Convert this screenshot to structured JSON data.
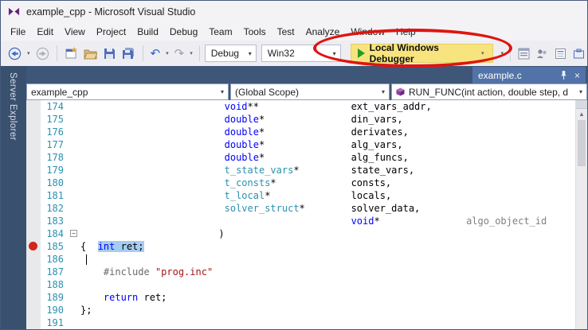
{
  "window": {
    "title": "example_cpp - Microsoft Visual Studio"
  },
  "menu": [
    "File",
    "Edit",
    "View",
    "Project",
    "Build",
    "Debug",
    "Team",
    "Tools",
    "Test",
    "Analyze",
    "Window",
    "Help"
  ],
  "toolbar": {
    "config": "Debug",
    "platform": "Win32",
    "debugger_button": "Local Windows Debugger"
  },
  "side_tab": "Server Explorer",
  "doc_tab": "example.c",
  "navbar": {
    "project": "example_cpp",
    "scope": "(Global Scope)",
    "member": "RUN_FUNC(int action, double step, d"
  },
  "colors": {
    "keyword": "#0000ff",
    "user_type": "#2b91af",
    "string": "#a31515",
    "line_number": "#2b91af",
    "breakpoint": "#d1261a",
    "selection": "#a6cdf0",
    "annotation_ellipse": "#de1510",
    "annotation_highlight": "#f8e47e",
    "tab_active": "#5273a7",
    "chrome": "#3e5678"
  },
  "editor": {
    "lines": [
      {
        "num": 174,
        "segments": [
          {
            "t": "                         ",
            "c": "pl"
          },
          {
            "t": "void",
            "c": "kw"
          },
          {
            "t": "**",
            "c": "pl"
          },
          {
            "t": "                ",
            "c": "pl"
          },
          {
            "t": "ext_vars_addr,",
            "c": "pl"
          }
        ]
      },
      {
        "num": 175,
        "segments": [
          {
            "t": "                         ",
            "c": "pl"
          },
          {
            "t": "double",
            "c": "kw"
          },
          {
            "t": "*",
            "c": "pl"
          },
          {
            "t": "               ",
            "c": "pl"
          },
          {
            "t": "din_vars,",
            "c": "pl"
          }
        ]
      },
      {
        "num": 176,
        "segments": [
          {
            "t": "                         ",
            "c": "pl"
          },
          {
            "t": "double",
            "c": "kw"
          },
          {
            "t": "*",
            "c": "pl"
          },
          {
            "t": "               ",
            "c": "pl"
          },
          {
            "t": "derivates,",
            "c": "pl"
          }
        ]
      },
      {
        "num": 177,
        "segments": [
          {
            "t": "                         ",
            "c": "pl"
          },
          {
            "t": "double",
            "c": "kw"
          },
          {
            "t": "*",
            "c": "pl"
          },
          {
            "t": "               ",
            "c": "pl"
          },
          {
            "t": "alg_vars,",
            "c": "pl"
          }
        ]
      },
      {
        "num": 178,
        "segments": [
          {
            "t": "                         ",
            "c": "pl"
          },
          {
            "t": "double",
            "c": "kw"
          },
          {
            "t": "*",
            "c": "pl"
          },
          {
            "t": "               ",
            "c": "pl"
          },
          {
            "t": "alg_funcs,",
            "c": "pl"
          }
        ]
      },
      {
        "num": 179,
        "segments": [
          {
            "t": "                         ",
            "c": "pl"
          },
          {
            "t": "t_state_vars",
            "c": "ty"
          },
          {
            "t": "*",
            "c": "pl"
          },
          {
            "t": "         ",
            "c": "pl"
          },
          {
            "t": "state_vars,",
            "c": "pl"
          }
        ]
      },
      {
        "num": 180,
        "segments": [
          {
            "t": "                         ",
            "c": "pl"
          },
          {
            "t": "t_consts",
            "c": "ty"
          },
          {
            "t": "*",
            "c": "pl"
          },
          {
            "t": "             ",
            "c": "pl"
          },
          {
            "t": "consts,",
            "c": "pl"
          }
        ]
      },
      {
        "num": 181,
        "segments": [
          {
            "t": "                         ",
            "c": "pl"
          },
          {
            "t": "t_local",
            "c": "ty"
          },
          {
            "t": "*",
            "c": "pl"
          },
          {
            "t": "              ",
            "c": "pl"
          },
          {
            "t": "locals,",
            "c": "pl"
          }
        ]
      },
      {
        "num": 182,
        "segments": [
          {
            "t": "                         ",
            "c": "pl"
          },
          {
            "t": "solver_struct",
            "c": "ty"
          },
          {
            "t": "*",
            "c": "pl"
          },
          {
            "t": "        ",
            "c": "pl"
          },
          {
            "t": "solver_data,",
            "c": "pl"
          }
        ]
      },
      {
        "num": 183,
        "segments": [
          {
            "t": "                                               ",
            "c": "pl"
          },
          {
            "t": "void",
            "c": "kw"
          },
          {
            "t": "*",
            "c": "pl"
          },
          {
            "t": "               ",
            "c": "pl"
          },
          {
            "t": "algo_object_id",
            "c": "dim"
          }
        ]
      },
      {
        "num": 184,
        "fold": true,
        "segments": [
          {
            "t": "                        ",
            "c": "pl"
          },
          {
            "t": ")",
            "c": "pl"
          }
        ]
      },
      {
        "num": 185,
        "breakpoint": true,
        "segments": [
          {
            "t": "{  ",
            "c": "pl"
          },
          {
            "t": "int",
            "c": "kw",
            "sel": true
          },
          {
            "t": " ret;",
            "c": "pl",
            "sel": true
          }
        ]
      },
      {
        "num": 186,
        "caret": true,
        "segments": [
          {
            "t": " ",
            "c": "pl"
          }
        ]
      },
      {
        "num": 187,
        "segments": [
          {
            "t": "    ",
            "c": "pl"
          },
          {
            "t": "#include",
            "c": "pp"
          },
          {
            "t": " ",
            "c": "pl"
          },
          {
            "t": "\"prog.inc\"",
            "c": "st"
          }
        ]
      },
      {
        "num": 188,
        "segments": []
      },
      {
        "num": 189,
        "segments": [
          {
            "t": "    ",
            "c": "pl"
          },
          {
            "t": "return",
            "c": "kw"
          },
          {
            "t": " ret;",
            "c": "pl"
          }
        ]
      },
      {
        "num": 190,
        "segments": [
          {
            "t": "};",
            "c": "pl"
          }
        ]
      },
      {
        "num": 191,
        "segments": []
      }
    ]
  }
}
